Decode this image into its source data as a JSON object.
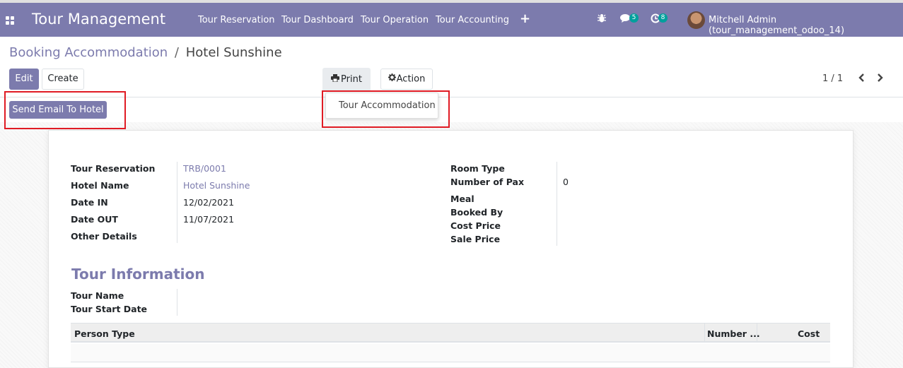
{
  "navbar": {
    "app_title": "Tour Management",
    "menus": [
      "Tour Reservation",
      "Tour Dashboard",
      "Tour Operation",
      "Tour Accounting"
    ],
    "add_icon": "+",
    "messages_count": "5",
    "activities_count": "8",
    "user": "Mitchell Admin (tour_management_odoo_14)"
  },
  "breadcrumb": {
    "parent": "Booking Accommodation",
    "separator": "/",
    "current": "Hotel Sunshine"
  },
  "toolbar": {
    "edit_label": "Edit",
    "create_label": "Create",
    "print_label": "Print",
    "action_label": "Action",
    "pager": "1 / 1"
  },
  "print_menu": {
    "items": [
      "Tour Accommodation"
    ]
  },
  "statusbar": {
    "send_email_label": "Send Email To Hotel"
  },
  "form": {
    "left": [
      {
        "label": "Tour Reservation",
        "value": "TRB/0001"
      },
      {
        "label": "Hotel Name",
        "value": "Hotel Sunshine"
      },
      {
        "label": "Date IN",
        "value": "12/02/2021"
      },
      {
        "label": "Date OUT",
        "value": "11/07/2021"
      },
      {
        "label": "Other Details",
        "value": ""
      }
    ],
    "right": [
      {
        "label": "Room Type",
        "value": ""
      },
      {
        "label": "Number of Pax",
        "value": "0"
      },
      {
        "label": "Meal",
        "value": ""
      },
      {
        "label": "Booked By",
        "value": ""
      },
      {
        "label": "Cost Price",
        "value": ""
      },
      {
        "label": "Sale Price",
        "value": ""
      }
    ]
  },
  "tour_information": {
    "title": "Tour Information",
    "fields": [
      {
        "label": "Tour Name",
        "value": ""
      },
      {
        "label": "Tour Start Date",
        "value": ""
      }
    ]
  },
  "person_table": {
    "columns": [
      "Person Type",
      "Number ...",
      "Cost"
    ]
  },
  "colors": {
    "brand": "#7c7bad",
    "highlight": "#e01b24",
    "badge": "#00a09d"
  },
  "icons": {
    "apps": "apps-grid-icon",
    "bug": "bug-icon",
    "chat": "chat-icon",
    "activity": "clock-icon",
    "print": "printer-icon",
    "action": "gear-icon",
    "prev": "chevron-left-icon",
    "next": "chevron-right-icon"
  }
}
